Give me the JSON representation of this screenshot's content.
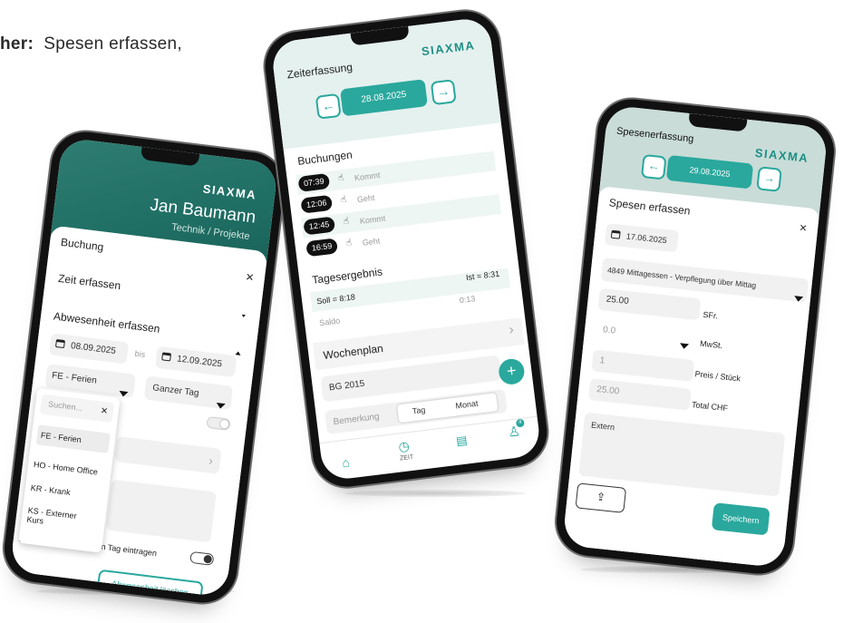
{
  "headline": {
    "bold": "her:",
    "rest": "Spesen erfassen,"
  },
  "brand": {
    "logo": "SIAXMA",
    "accent": "#2aa89d",
    "dark_teal": "#1f6e64"
  },
  "phone1": {
    "user_name": "Jan Baumann",
    "user_role": "Technik / Projekte",
    "sheet_title": "Buchung",
    "close": "×",
    "section_time": "Zeit erfassen",
    "section_absence": "Abwesenheit erfassen",
    "date_from": "08.09.2025",
    "bis": "bis",
    "date_to": "12.09.2025",
    "absence_type": "FE - Ferien",
    "duration": "Ganzer Tag",
    "dropdown": {
      "search_placeholder": "Suchen...",
      "close": "×",
      "options": [
        "FE - Ferien",
        "HO - Home Office",
        "KR - Krank",
        "KS - Externer Kurs"
      ]
    },
    "row_stub_letter_top": "V",
    "row_stub_letter_bottom": "E",
    "every_day_label": "en Tag eintragen",
    "delete_button": "Abwesenheit löschen"
  },
  "phone2": {
    "title": "Zeiterfassung",
    "date": "28.08.2025",
    "bookings_title": "Buchungen",
    "bookings": [
      {
        "time": "07:39",
        "label": "Kommt"
      },
      {
        "time": "12:06",
        "label": "Geht"
      },
      {
        "time": "12:45",
        "label": "Kommt"
      },
      {
        "time": "16:59",
        "label": "Geht"
      }
    ],
    "result_title": "Tagesergebnis",
    "soll": "Soll = 8:18",
    "ist": "Ist = 8:31",
    "saldo_label": "Saldo",
    "saldo_value": "0:13",
    "weekplan_title": "Wochenplan",
    "project": "BG 2015",
    "remark_placeholder": "Bemerkung",
    "seg_day": "Tag",
    "seg_month": "Monat",
    "fab": "+",
    "nav_time_label": "ZEIT",
    "badge": "4"
  },
  "phone3": {
    "title": "Spesenerfassung",
    "date": "29.08.2025",
    "sheet_title": "Spesen erfassen",
    "close": "×",
    "expense_date": "17.06.2025",
    "expense_type": "4849 Mittagessen - Verpflegung über Mittag",
    "amount": "25.00",
    "currency": "SFr.",
    "vat_value": "0.0",
    "vat_label": "MwSt.",
    "unit_price_value": "1",
    "unit_price_label": "Preis / Stück",
    "total_value": "25.00",
    "total_label": "Total CHF",
    "remark_placeholder": "Extern",
    "save_button": "Speichern"
  }
}
